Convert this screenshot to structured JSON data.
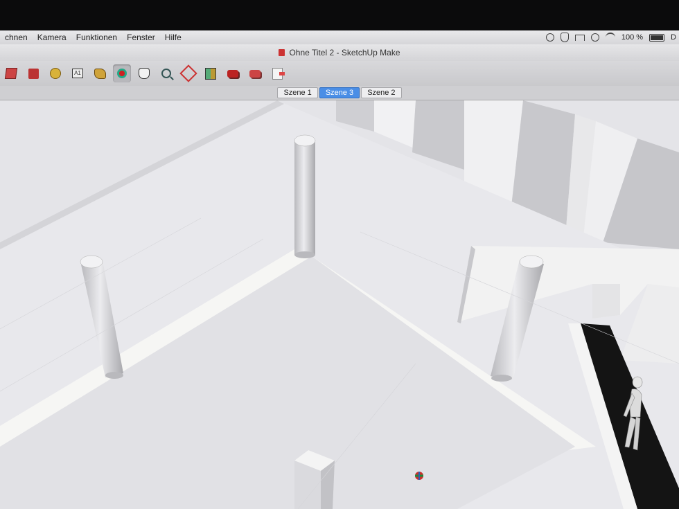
{
  "menubar": {
    "items": [
      "chnen",
      "Kamera",
      "Funktionen",
      "Fenster",
      "Hilfe"
    ],
    "battery_text": "100 %",
    "extra_text": "D"
  },
  "window": {
    "title": "Ohne Titel 2 - SketchUp Make"
  },
  "toolbar": {
    "tools": [
      {
        "name": "select-icon",
        "active": false
      },
      {
        "name": "make-component-icon",
        "active": false
      },
      {
        "name": "tape-measure-icon",
        "active": false
      },
      {
        "name": "text-tool-icon",
        "active": false
      },
      {
        "name": "paint-bucket-icon",
        "active": false
      },
      {
        "name": "orbit-icon",
        "active": true
      },
      {
        "name": "pan-hand-icon",
        "active": false
      },
      {
        "name": "zoom-icon",
        "active": false
      },
      {
        "name": "zoom-extents-icon",
        "active": false
      },
      {
        "name": "add-location-icon",
        "active": false
      },
      {
        "name": "3d-warehouse-icon",
        "active": false
      },
      {
        "name": "share-model-icon",
        "active": false
      },
      {
        "name": "export-icon",
        "active": false
      }
    ],
    "text_tool_label": "A1"
  },
  "scenes": {
    "tabs": [
      "Szene 1",
      "Szene 3",
      "Szene 2"
    ],
    "active": "Szene 3"
  }
}
